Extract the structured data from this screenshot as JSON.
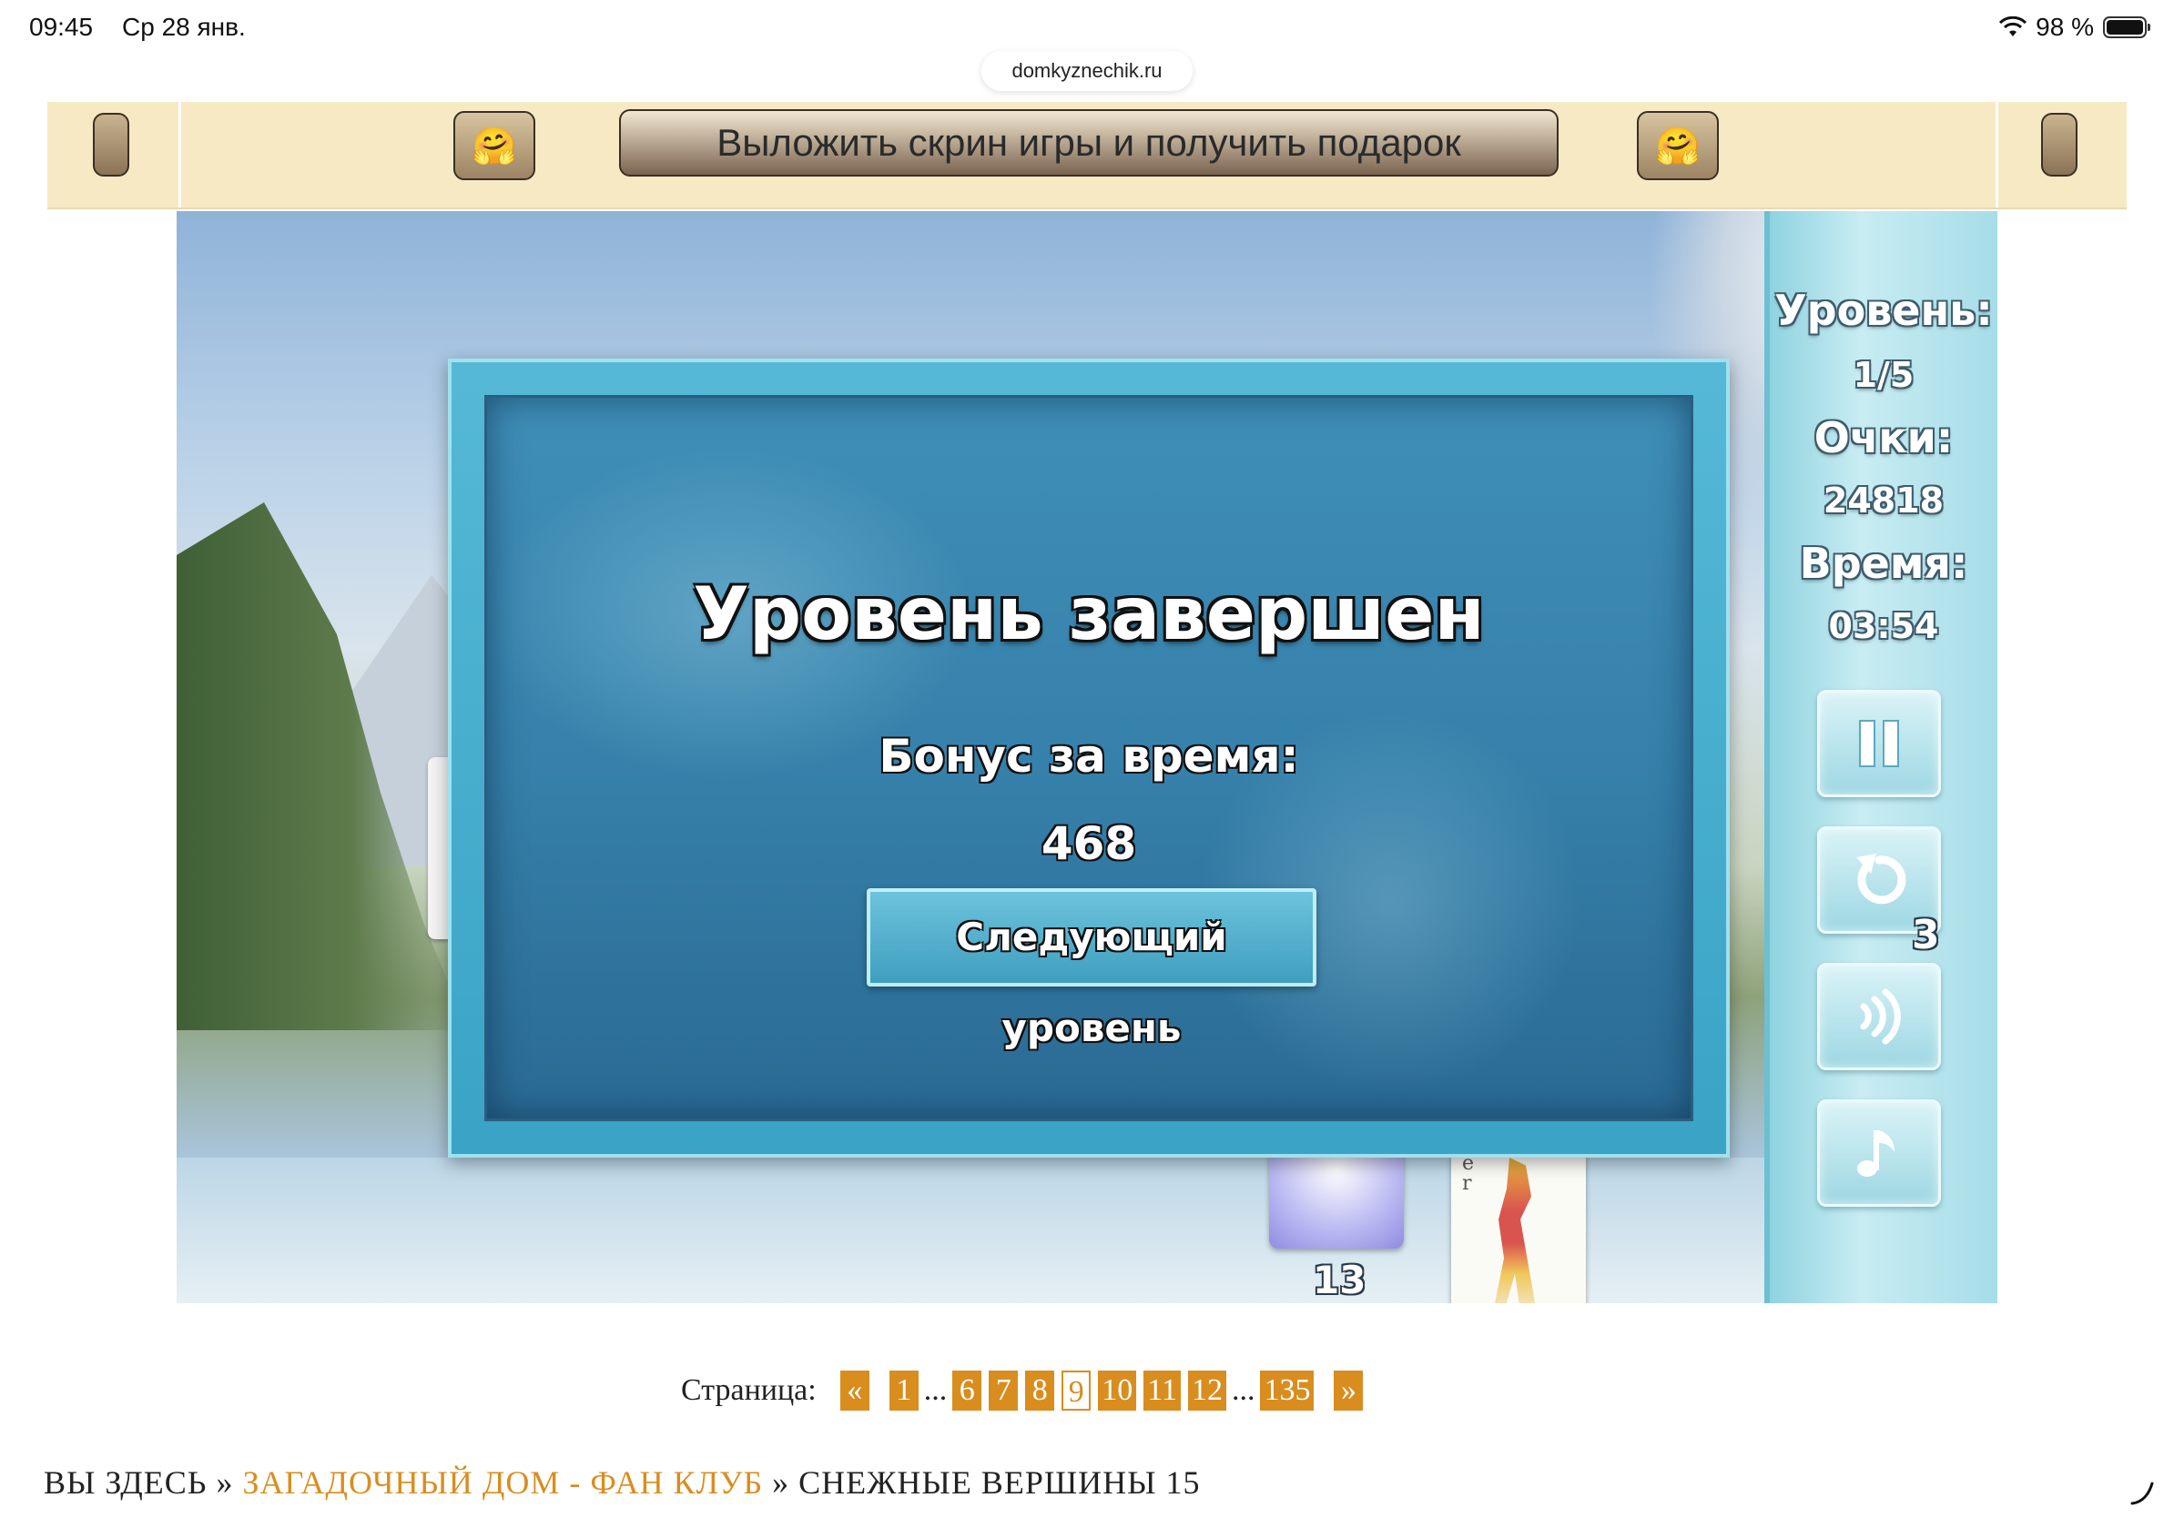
{
  "status_bar": {
    "time": "09:45",
    "date": "Ср 28 янв.",
    "battery": "98 %",
    "url": "domkyznechik.ru"
  },
  "banner": {
    "promo_text": "Выложить скрин игры и получить подарок",
    "emoji": "🤗"
  },
  "game": {
    "side_panel": {
      "level_label": "Уровень:",
      "level_value": "1/5",
      "score_label": "Очки:",
      "score_value": "24818",
      "time_label": "Время:",
      "time_value": "03:54",
      "undo_count": "3",
      "buttons": [
        "pause-icon",
        "undo-icon",
        "sound-icon",
        "music-icon"
      ]
    },
    "deck_count": "13",
    "joker_letters": "e r",
    "modal": {
      "title": "Уровень завершен",
      "bonus_label": "Бонус за время:",
      "bonus_value": "468",
      "next_button": "Следующий уровень"
    }
  },
  "pagination": {
    "label": "Страница:",
    "prev": "«",
    "next": "»",
    "pages": [
      "1",
      "6",
      "7",
      "8",
      "9",
      "10",
      "11",
      "12",
      "135"
    ],
    "current": "9",
    "ellipsis": "..."
  },
  "breadcrumb": {
    "prefix": "ВЫ ЗДЕСЬ",
    "sep": "»",
    "link": "ЗАГАДОЧНЫЙ ДОМ - ФАН КЛУБ",
    "current": "СНЕЖНЫЕ ВЕРШИНЫ 15"
  },
  "colors": {
    "accent": "#d98d1f",
    "banner_bg": "#f6e9c4",
    "ice": "#3f8fb8"
  }
}
